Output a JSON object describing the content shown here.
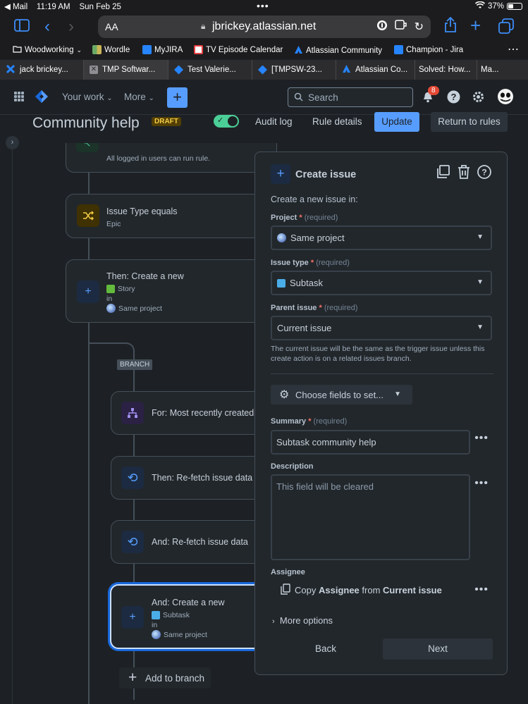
{
  "status_bar": {
    "back_app": "◀ Mail",
    "time": "11:19 AM",
    "date": "Sun Feb 25",
    "battery": "37%"
  },
  "safari": {
    "aa": "AA",
    "url": "jbrickey.atlassian.net"
  },
  "bookmarks": [
    {
      "label": "Woodworking",
      "color": "#ffffff"
    },
    {
      "label": "Wordle",
      "color": "#6aaa64"
    },
    {
      "label": "MyJIRA",
      "color": "#2684ff"
    },
    {
      "label": "TV Episode Calendar",
      "color": "#e64040"
    },
    {
      "label": "Atlassian Community",
      "color": "#2684ff"
    },
    {
      "label": "Champion - Jira",
      "color": "#2684ff"
    }
  ],
  "tabs": [
    {
      "label": "jack brickey...",
      "color": "#2684ff"
    },
    {
      "label": "TMP Softwar...",
      "color": "#ffffff"
    },
    {
      "label": "Test Valerie...",
      "color": "#2684ff"
    },
    {
      "label": "[TMPSW-23...",
      "color": "#2684ff"
    },
    {
      "label": "Atlassian Co...",
      "color": "#2684ff"
    },
    {
      "label": "Solved: How...",
      "color": ""
    },
    {
      "label": "Ma...",
      "color": ""
    }
  ],
  "jira_nav": {
    "your_work": "Your work",
    "more": "More",
    "search_placeholder": "Search",
    "notifications_count": "8"
  },
  "header": {
    "title": "Community help",
    "draft": "DRAFT",
    "audit_log": "Audit log",
    "rule_details": "Rule details",
    "update": "Update",
    "return": "Return to rules"
  },
  "flow": {
    "trigger_sub": "All logged in users can run rule.",
    "condition_title": "Issue Type equals",
    "condition_sub": "Epic",
    "action_title": "Then: Create a new",
    "action_type": "Story",
    "action_in": "in",
    "action_project": "Same project",
    "branch_label": "BRANCH",
    "branch_for": "For: Most recently created",
    "refetch1": "Then: Re-fetch issue data",
    "refetch2": "And: Re-fetch issue data",
    "create_sub_title": "And: Create a new",
    "create_sub_type": "Subtask",
    "create_sub_in": "in",
    "create_sub_project": "Same project",
    "add_to_branch": "Add to branch"
  },
  "panel": {
    "title": "Create issue",
    "intro": "Create a new issue in:",
    "project_label": "Project",
    "required_text": "(required)",
    "project_value": "Same project",
    "issue_type_label": "Issue type",
    "issue_type_value": "Subtask",
    "parent_label": "Parent issue",
    "parent_value": "Current issue",
    "parent_help": "The current issue will be the same as the trigger issue unless this create action is on a related issues branch.",
    "choose_fields": "Choose fields to set...",
    "summary_label": "Summary",
    "summary_value": "Subtask community help",
    "description_label": "Description",
    "description_placeholder": "This field will be cleared",
    "assignee_label": "Assignee",
    "assignee_copy": "Copy",
    "assignee_field": "Assignee",
    "assignee_from": "from",
    "assignee_source": "Current issue",
    "more_options": "More options",
    "back": "Back",
    "next": "Next"
  },
  "colors": {
    "accent": "#579dff",
    "background": "#1d2125",
    "surface": "#22272b",
    "success": "#4bce97"
  }
}
